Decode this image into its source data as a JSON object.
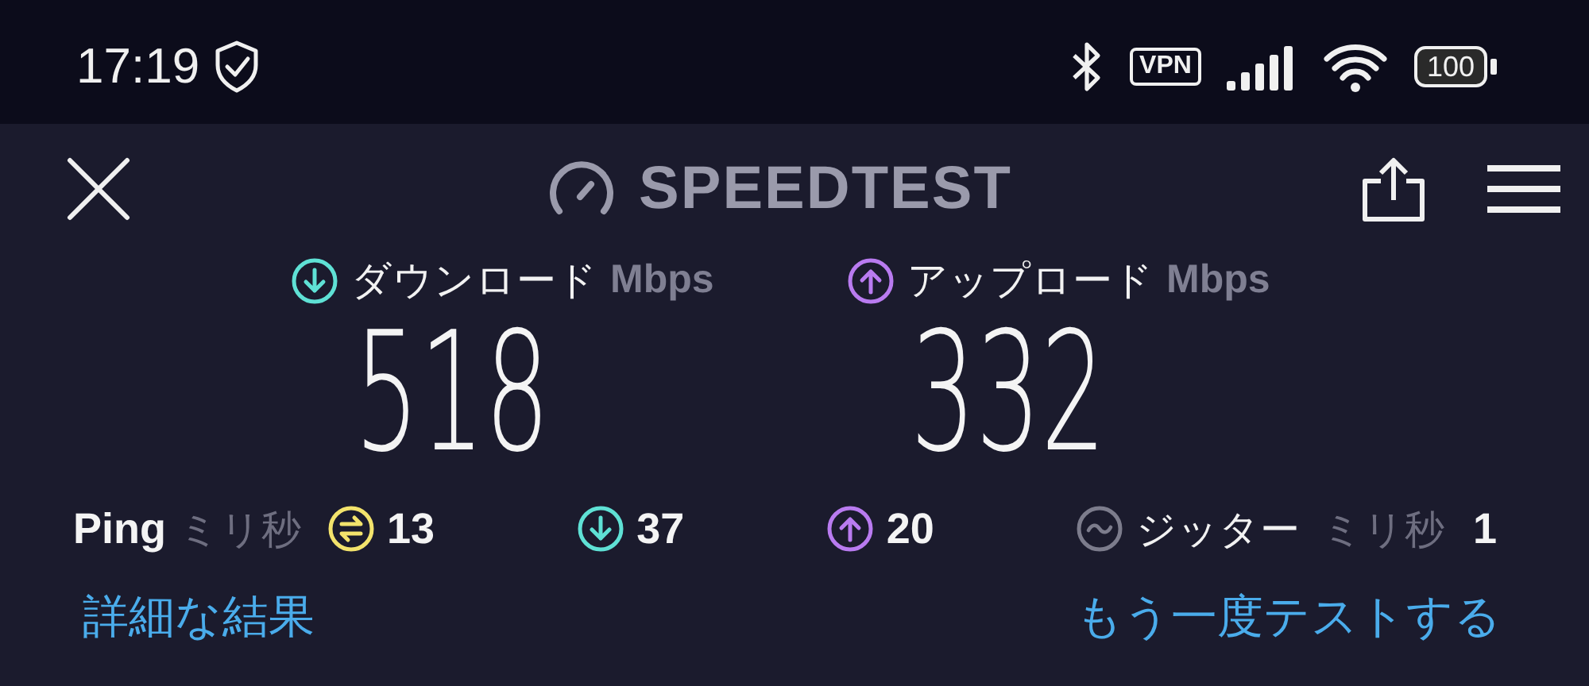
{
  "status_bar": {
    "time": "17:19",
    "vpn": "VPN",
    "battery": "100"
  },
  "header": {
    "title": "SPEEDTEST"
  },
  "results": [
    {
      "kind": "download",
      "label": "ダウンロード",
      "unit": "Mbps",
      "value": "518"
    },
    {
      "kind": "upload",
      "label": "アップロード",
      "unit": "Mbps",
      "value": "332"
    }
  ],
  "ping": {
    "label": "Ping",
    "unit": "ミリ秒",
    "stats": [
      {
        "kind": "ping",
        "value": "13"
      },
      {
        "kind": "download",
        "value": "37"
      },
      {
        "kind": "upload",
        "value": "20"
      }
    ]
  },
  "jitter": {
    "label": "ジッター",
    "unit": "ミリ秒",
    "value": "1"
  },
  "links": [
    "詳細な結果",
    "もう一度テストする"
  ]
}
